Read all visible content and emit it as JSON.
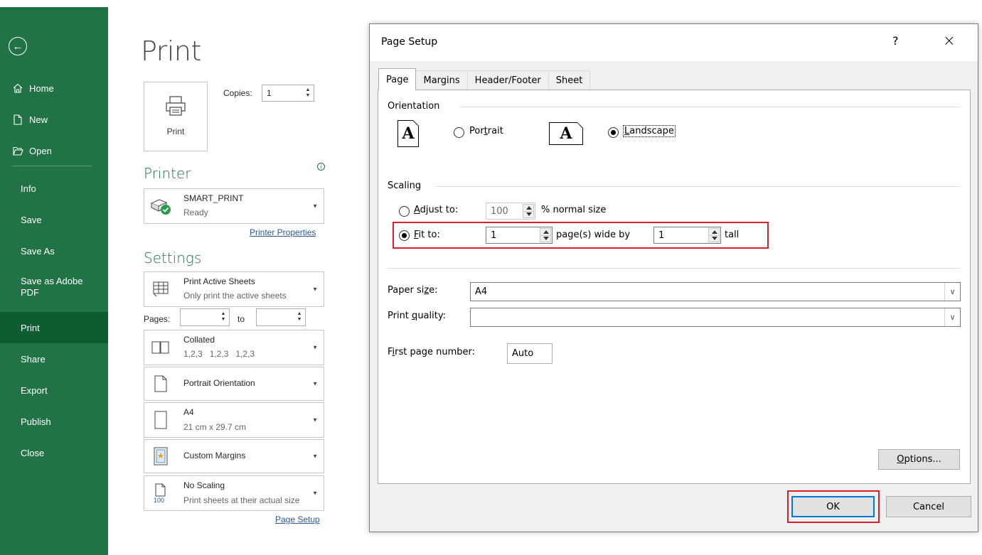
{
  "sidebar": {
    "back_icon": "back-arrow-icon",
    "items": [
      {
        "label": "Home",
        "icon": "home-icon"
      },
      {
        "label": "New",
        "icon": "new-document-icon"
      },
      {
        "label": "Open",
        "icon": "open-folder-icon"
      },
      {
        "label": "Info"
      },
      {
        "label": "Save"
      },
      {
        "label": "Save As"
      },
      {
        "label": "Save as Adobe"
      },
      {
        "label": "PDF"
      },
      {
        "label": "Print",
        "active": true
      },
      {
        "label": "Share"
      },
      {
        "label": "Export"
      },
      {
        "label": "Publish"
      },
      {
        "label": "Close"
      }
    ]
  },
  "print_panel": {
    "title": "Print",
    "print_button_label": "Print",
    "copies_label": "Copies:",
    "copies_value": "1",
    "printer_heading": "Printer",
    "printer": {
      "name": "SMART_PRINT",
      "status": "Ready"
    },
    "printer_properties_link": "Printer Properties",
    "settings_heading": "Settings",
    "settings": [
      {
        "line1": "Print Active Sheets",
        "line2": "Only print the active sheets"
      },
      {
        "line1": "Collated",
        "line2": "1,2,3   1,2,3   1,2,3"
      },
      {
        "line1": "Portrait Orientation",
        "line2": ""
      },
      {
        "line1": "A4",
        "line2": "21 cm x 29.7 cm"
      },
      {
        "line1": "Custom Margins",
        "line2": ""
      },
      {
        "line1": "No Scaling",
        "line2": "Print sheets at their actual size",
        "icon_text": "100"
      }
    ],
    "pages_label": "Pages:",
    "to_label": "to",
    "page_setup_link": "Page Setup"
  },
  "dialog": {
    "title": "Page Setup",
    "help": "?",
    "close": "×",
    "tabs": [
      "Page",
      "Margins",
      "Header/Footer",
      "Sheet"
    ],
    "active_tab": "Page",
    "orientation_label": "Orientation",
    "portrait_pre": "Por",
    "portrait_u": "t",
    "portrait_post": "rait",
    "landscape_u": "L",
    "landscape_post": "andscape",
    "orientation_glyph": "A",
    "selected_orientation": "Landscape",
    "scaling_label": "Scaling",
    "adjust_u": "A",
    "adjust_post": "djust to:",
    "adjust_value": "100",
    "normal_size_label": "% normal size",
    "fit_u": "F",
    "fit_post": "it to:",
    "fit_wide_value": "1",
    "wide_by_label": "page(s) wide by",
    "fit_tall_value": "1",
    "tall_label": "tall",
    "scaling_mode": "Fit to",
    "paper_size_pre": "Paper si",
    "paper_size_u": "z",
    "paper_size_post": "e:",
    "paper_size_value": "A4",
    "print_quality_pre": "Print ",
    "print_quality_u": "q",
    "print_quality_post": "uality:",
    "print_quality_value": "",
    "first_page_pre": "F",
    "first_page_u": "i",
    "first_page_post": "rst page number:",
    "first_page_value": "Auto",
    "options_u": "O",
    "options_post": "ptions...",
    "ok_label": "OK",
    "cancel_label": "Cancel",
    "highlight_color": "#d81f2a"
  },
  "colors": {
    "excel_green": "#217346",
    "active_item": "#0e5c30",
    "link_blue": "#2b579a",
    "default_button_border": "#0078d7"
  }
}
